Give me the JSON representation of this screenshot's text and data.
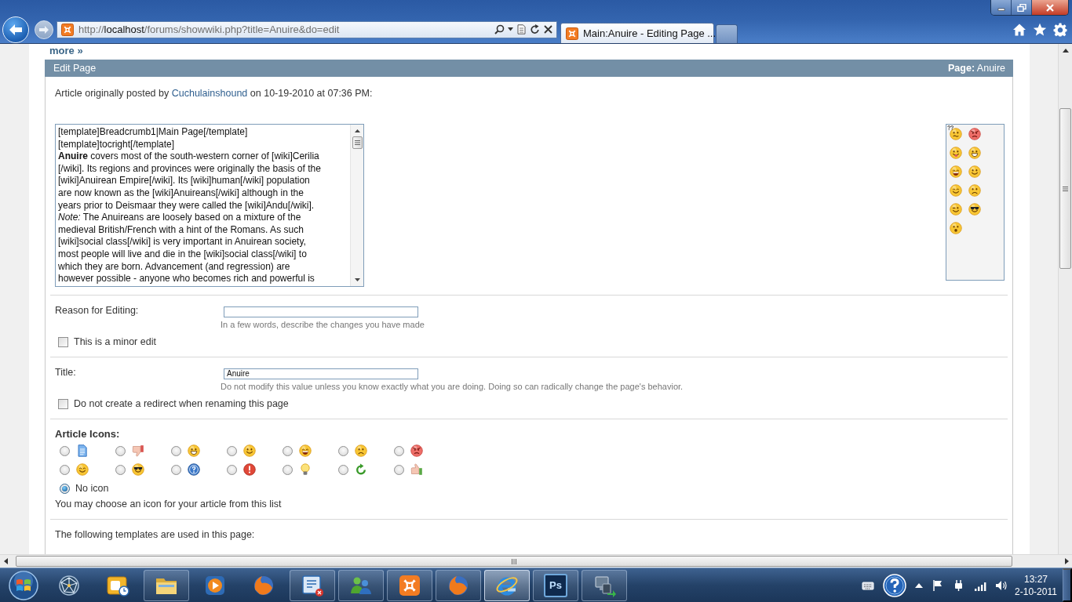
{
  "browser": {
    "url": {
      "scheme": "http://",
      "host": "localhost",
      "path": "/forums/showwiki.php?title=Anuire&do=edit"
    },
    "tabs": [
      {
        "title": "Main:Anuire - Editing Page ...",
        "selected": true
      }
    ]
  },
  "page": {
    "more_link": "more »",
    "panel": {
      "title": "Edit Page",
      "page": "**Page:** Anuire"
    },
    "posted_by": {
      "before": "Article originally posted by",
      "author": "Cuchulainshound",
      "after": "on 10-19-2010 at 07:36 PM:"
    },
    "editor": {
      "lines": [
        "[template]Breadcrumb1|Main Page[/template]",
        "[template]tocright[/template]",
        "**Anuire** covers most of the south-western corner of [wiki]Cerilia",
        "[/wiki]. Its regions and provinces were originally the basis of the",
        "[wiki]Anuirean Empire[/wiki]. Its [wiki]human[/wiki] population",
        "are now known as the [wiki]Anuireans[/wiki] although in the",
        "years prior to Deismaar they were called the [wiki]Andu[/wiki].",
        "*Note:* The Anuireans are loosely based on a mixture of the",
        "medieval British/French with a hint of the Romans. As such",
        "[wiki]social class[/wiki] is very important in Anuirean society,",
        "most people will live and die in the [wiki]social class[/wiki] to",
        "which they are born. Advancement (and regression) are",
        "however possible - anyone who becomes rich and powerful is"
      ]
    },
    "reason": {
      "label": "Reason for Editing:",
      "hint": "In a few words, describe the changes you have made",
      "minor_edit": {
        "label": "This is a minor edit",
        "checked": false
      }
    },
    "title": {
      "label": "Title:",
      "value": "Anuire",
      "hint": "Do not modify this value unless you know exactly what you are doing. Doing so can radically change the page's behavior.",
      "no_redirect": {
        "label": "Do not create a redirect when renaming this page",
        "checked": false
      }
    },
    "article_icons": {
      "heading": "Article Icons:",
      "options": [
        {
          "kind": "document",
          "selected": false
        },
        {
          "kind": "thumbs_down",
          "selected": false
        },
        {
          "kind": "grin",
          "selected": false
        },
        {
          "kind": "smile",
          "selected": false
        },
        {
          "kind": "laugh",
          "selected": false
        },
        {
          "kind": "frown",
          "selected": false
        },
        {
          "kind": "mad",
          "selected": false
        },
        {
          "kind": "happy",
          "selected": false
        },
        {
          "kind": "cool",
          "selected": false
        },
        {
          "kind": "question",
          "selected": false
        },
        {
          "kind": "exclamation",
          "selected": false
        },
        {
          "kind": "lightbulb",
          "selected": false
        },
        {
          "kind": "arrow",
          "selected": false
        },
        {
          "kind": "thumbs_up",
          "selected": false
        }
      ],
      "no_icon": {
        "label": "No icon",
        "selected": true
      },
      "help": "You may choose an icon for your article from this list"
    },
    "templates_heading": "The following templates are used in this page:"
  },
  "taskbar": {
    "items": [
      {
        "kind": "network",
        "running": false,
        "selected": false
      },
      {
        "kind": "outlook",
        "running": false,
        "selected": false
      },
      {
        "kind": "explorer",
        "running": true,
        "selected": false
      },
      {
        "kind": "media",
        "running": false,
        "selected": false
      },
      {
        "kind": "firefox",
        "running": false,
        "selected": false
      },
      {
        "kind": "remote",
        "running": true,
        "selected": false
      },
      {
        "kind": "messenger",
        "running": true,
        "selected": false
      },
      {
        "kind": "xampp",
        "running": true,
        "selected": false
      },
      {
        "kind": "firefox",
        "running": true,
        "selected": false
      },
      {
        "kind": "ie",
        "running": true,
        "selected": true
      },
      {
        "kind": "photoshop",
        "label": "Ps",
        "running": true,
        "selected": false
      },
      {
        "kind": "netlock",
        "running": true,
        "selected": false
      }
    ],
    "clock": {
      "time": "13:27",
      "date": "2-10-2011"
    }
  }
}
